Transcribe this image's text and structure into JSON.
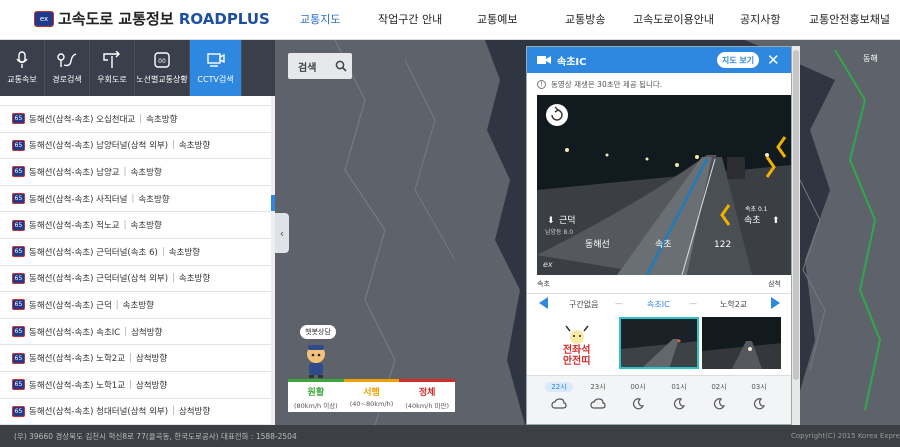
{
  "header": {
    "logo_badge": "ex",
    "logo_title": "고속도로 교통정보",
    "logo_brand": "ROADPLUS",
    "nav": [
      "교통지도",
      "작업구간 안내",
      "교통예보",
      "교통방송",
      "고속도로이용안내",
      "공지사항",
      "교통안전홍보채널"
    ],
    "active_nav": "교통지도"
  },
  "tools": [
    {
      "label": "교통속보",
      "icon": "microphone-icon"
    },
    {
      "label": "경로검색",
      "icon": "route-icon"
    },
    {
      "label": "우회도로",
      "icon": "detour-icon"
    },
    {
      "label": "노선별교통상황",
      "icon": "route-shield-icon"
    },
    {
      "label": "CCTV검색",
      "icon": "cctv-icon"
    }
  ],
  "list": {
    "badge": "65",
    "items": [
      {
        "name": "",
        "dir": ""
      },
      {
        "name": "동해선(삼척-속초) 오십천대교",
        "dir": "속초방향"
      },
      {
        "name": "동해선(삼척-속초) 남양터널(삼척 외부)",
        "dir": "속초방향"
      },
      {
        "name": "동해선(삼척-속초) 남양교",
        "dir": "속초방향"
      },
      {
        "name": "동해선(삼척-속초) 사직터널",
        "dir": "속초방향"
      },
      {
        "name": "동해선(삼척-속초) 적노교",
        "dir": "속초방향"
      },
      {
        "name": "동해선(삼척-속초) 근덕터널(속초 6)",
        "dir": "속초방향"
      },
      {
        "name": "동해선(삼척-속초) 근덕터널(삼척 외부)",
        "dir": "속초방향"
      },
      {
        "name": "동해선(삼척-속초) 근덕",
        "dir": "속초방향"
      },
      {
        "name": "동해선(삼척-속초) 속초IC",
        "dir": "삼척방향"
      },
      {
        "name": "동해선(삼척-속초) 노학2교",
        "dir": "삼척방향"
      },
      {
        "name": "동해선(삼척-속초) 노학1교",
        "dir": "삼척방향"
      },
      {
        "name": "동해선(삼척-속초) 청대터널(삼척 외부)",
        "dir": "삼척방향"
      }
    ]
  },
  "map": {
    "search_label": "검색",
    "mascot_bubble": "챗봇상담",
    "region_label": "동해",
    "legend": [
      {
        "name": "원활",
        "range": "(80km/h 이상)",
        "color": "#3aa83a"
      },
      {
        "name": "서행",
        "range": "(40~80km/h)",
        "color": "#f2a100"
      },
      {
        "name": "정체",
        "range": "(40km/h 미만)",
        "color": "#d62b2b"
      }
    ]
  },
  "cctv": {
    "title": "속초IC",
    "map_view_label": "지도 보기",
    "notice": "동영상 재생은 30초만 제공 됩니다.",
    "video": {
      "sign_text": "근덕",
      "sign_sub": "남양동 8.0",
      "road_name": "동해선",
      "road_dir": "속초",
      "road_no": "122",
      "sign_right_top": "속초 0.1",
      "sign_right": "속초",
      "watermark": "ex"
    },
    "video_left_label": "속초",
    "video_right_label": "삼척",
    "nav": {
      "prev": "구간없음",
      "current": "속초IC",
      "next": "노학2교",
      "dash": "—"
    },
    "campaign_text": "전좌석\n안전띠",
    "weather_hours": [
      "22시",
      "23시",
      "00시",
      "01시",
      "02시",
      "03시"
    ],
    "weather_icons": [
      "cloud-icon",
      "cloud-icon",
      "moon-icon",
      "moon-icon",
      "moon-icon",
      "moon-icon"
    ],
    "weather_current": "22시"
  },
  "footer": {
    "address": "(우) 39660 경상북도 김천시 혁신8로 77(율곡동, 한국도로공사) 대표전화 : 1588-2504",
    "copyright": "Copyright(C) 2015 Korea Expre"
  }
}
